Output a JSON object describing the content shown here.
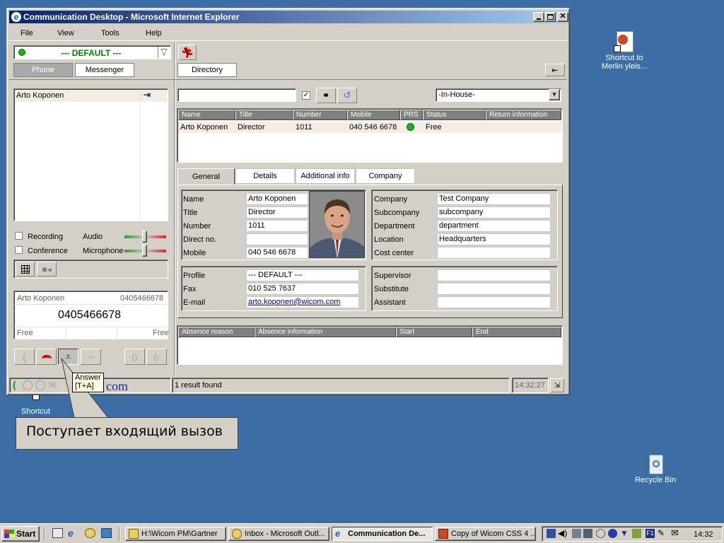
{
  "window": {
    "title": "Communication Desktop - Microsoft Internet Explorer",
    "menu": [
      "File",
      "View",
      "Tools",
      "Help"
    ]
  },
  "profile": {
    "selected": "--- DEFAULT ---"
  },
  "left_tabs": {
    "phone": "Phone",
    "messenger": "Messenger"
  },
  "directory_tab": "Directory",
  "call_list": [
    {
      "name": "Arto Koponen"
    }
  ],
  "controls": {
    "recording": "Recording",
    "audio": "Audio",
    "conference": "Conference",
    "microphone": "Microphone"
  },
  "call_panel": {
    "name": "Arto Koponen",
    "number": "0405466678",
    "dial": "0405466678",
    "status_left": "Free",
    "status_right": "Free"
  },
  "tooltip": {
    "line1": "Answer",
    "line2": "[T+A]"
  },
  "logo_text": "com",
  "status": {
    "results": "1 result found",
    "time": "14:32:27"
  },
  "search": {
    "query": "",
    "checked": true,
    "scope": "-In-House-"
  },
  "results": {
    "columns": [
      "Name",
      "Title",
      "Number",
      "Mobile",
      "PRS",
      "Status",
      "Return information"
    ],
    "rows": [
      {
        "name": "Arto Koponen",
        "title": "Director",
        "number": "1011",
        "mobile": "040 546 6678",
        "prs_color": "#19b219",
        "status": "Free",
        "return_info": ""
      }
    ]
  },
  "detail_tabs": [
    "General",
    "Details",
    "Additional info",
    "Company"
  ],
  "general": {
    "personal_labels": [
      "Name",
      "Title",
      "Number",
      "Direct no.",
      "Mobile"
    ],
    "personal_values": [
      "Arto Koponen",
      "Director",
      "1011",
      "",
      "040 546 6678"
    ],
    "company_labels": [
      "Company",
      "Subcompany",
      "Department",
      "Location",
      "Cost center"
    ],
    "company_values": [
      "Test Company",
      "subcompany",
      "department",
      "Headquarters",
      ""
    ],
    "contact_labels": [
      "Profile",
      "Fax",
      "E-mail"
    ],
    "contact_values": [
      "--- DEFAULT ---",
      "010 525 7637",
      "arto.koponen@wicom.com"
    ],
    "relation_labels": [
      "Supervisor",
      "Substitute",
      "Assistant"
    ],
    "relation_values": [
      "",
      "",
      ""
    ]
  },
  "absence": {
    "columns": [
      "Absence reason",
      "Absence information",
      "Start",
      "End"
    ]
  },
  "caption": "Поступает входящий вызов",
  "desktop": {
    "shortcut1": [
      "Shortcut to",
      "Merlin yleis..."
    ],
    "shortcut2": "Shortcut",
    "recycle": "Recycle Bin"
  },
  "taskbar": {
    "start": "Start",
    "tasks": [
      "H:\\Wicom PM\\Gartner",
      "Inbox - Microsoft Outl...",
      "Communication De...",
      "Copy of Wicom CSS 4 ..."
    ],
    "clock": "14:32"
  }
}
